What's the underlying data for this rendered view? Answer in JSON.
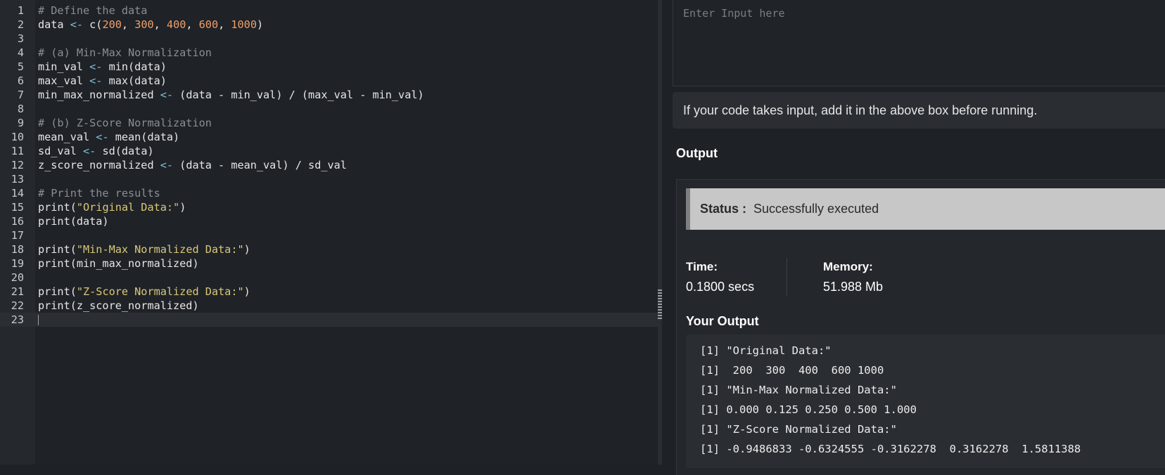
{
  "editor": {
    "lines": [
      {
        "n": "1",
        "tokens": [
          {
            "t": "# Define the data",
            "c": "comment"
          }
        ]
      },
      {
        "n": "2",
        "tokens": [
          {
            "t": "data ",
            "c": "plain"
          },
          {
            "t": "<-",
            "c": "op"
          },
          {
            "t": " c(",
            "c": "plain"
          },
          {
            "t": "200",
            "c": "num"
          },
          {
            "t": ", ",
            "c": "plain"
          },
          {
            "t": "300",
            "c": "num"
          },
          {
            "t": ", ",
            "c": "plain"
          },
          {
            "t": "400",
            "c": "num"
          },
          {
            "t": ", ",
            "c": "plain"
          },
          {
            "t": "600",
            "c": "num"
          },
          {
            "t": ", ",
            "c": "plain"
          },
          {
            "t": "1000",
            "c": "num"
          },
          {
            "t": ")",
            "c": "plain"
          }
        ]
      },
      {
        "n": "3",
        "tokens": []
      },
      {
        "n": "4",
        "tokens": [
          {
            "t": "# (a) Min-Max Normalization",
            "c": "comment"
          }
        ]
      },
      {
        "n": "5",
        "tokens": [
          {
            "t": "min_val ",
            "c": "plain"
          },
          {
            "t": "<-",
            "c": "op"
          },
          {
            "t": " min(data)",
            "c": "plain"
          }
        ]
      },
      {
        "n": "6",
        "tokens": [
          {
            "t": "max_val ",
            "c": "plain"
          },
          {
            "t": "<-",
            "c": "op"
          },
          {
            "t": " max(data)",
            "c": "plain"
          }
        ]
      },
      {
        "n": "7",
        "tokens": [
          {
            "t": "min_max_normalized ",
            "c": "plain"
          },
          {
            "t": "<-",
            "c": "op"
          },
          {
            "t": " (data - min_val) / (max_val - min_val)",
            "c": "plain"
          }
        ]
      },
      {
        "n": "8",
        "tokens": []
      },
      {
        "n": "9",
        "tokens": [
          {
            "t": "# (b) Z-Score Normalization",
            "c": "comment"
          }
        ]
      },
      {
        "n": "10",
        "tokens": [
          {
            "t": "mean_val ",
            "c": "plain"
          },
          {
            "t": "<-",
            "c": "op"
          },
          {
            "t": " mean(data)",
            "c": "plain"
          }
        ]
      },
      {
        "n": "11",
        "tokens": [
          {
            "t": "sd_val ",
            "c": "plain"
          },
          {
            "t": "<-",
            "c": "op"
          },
          {
            "t": " sd(data)",
            "c": "plain"
          }
        ]
      },
      {
        "n": "12",
        "tokens": [
          {
            "t": "z_score_normalized ",
            "c": "plain"
          },
          {
            "t": "<-",
            "c": "op"
          },
          {
            "t": " (data - mean_val) / sd_val",
            "c": "plain"
          }
        ]
      },
      {
        "n": "13",
        "tokens": []
      },
      {
        "n": "14",
        "tokens": [
          {
            "t": "# Print the results",
            "c": "comment"
          }
        ]
      },
      {
        "n": "15",
        "tokens": [
          {
            "t": "print(",
            "c": "plain"
          },
          {
            "t": "\"Original Data:\"",
            "c": "str"
          },
          {
            "t": ")",
            "c": "plain"
          }
        ]
      },
      {
        "n": "16",
        "tokens": [
          {
            "t": "print(data)",
            "c": "plain"
          }
        ]
      },
      {
        "n": "17",
        "tokens": []
      },
      {
        "n": "18",
        "tokens": [
          {
            "t": "print(",
            "c": "plain"
          },
          {
            "t": "\"Min-Max Normalized Data:\"",
            "c": "str"
          },
          {
            "t": ")",
            "c": "plain"
          }
        ]
      },
      {
        "n": "19",
        "tokens": [
          {
            "t": "print(min_max_normalized)",
            "c": "plain"
          }
        ]
      },
      {
        "n": "20",
        "tokens": []
      },
      {
        "n": "21",
        "tokens": [
          {
            "t": "print(",
            "c": "plain"
          },
          {
            "t": "\"Z-Score Normalized Data:\"",
            "c": "str"
          },
          {
            "t": ")",
            "c": "plain"
          }
        ]
      },
      {
        "n": "22",
        "tokens": [
          {
            "t": "print(z_score_normalized)",
            "c": "plain"
          }
        ]
      },
      {
        "n": "23",
        "tokens": [],
        "active": true
      }
    ]
  },
  "input": {
    "placeholder": "Enter Input here",
    "value": ""
  },
  "hint": "If your code takes input, add it in the above box before running.",
  "output": {
    "title": "Output",
    "status_label": "Status :",
    "status_value": "Successfully executed",
    "time_label": "Time:",
    "time_value": "0.1800 secs",
    "memory_label": "Memory:",
    "memory_value": "51.988 Mb",
    "your_output_label": "Your Output",
    "lines": [
      "[1] \"Original Data:\"",
      "[1]  200  300  400  600 1000",
      "[1] \"Min-Max Normalized Data:\"",
      "[1] 0.000 0.125 0.250 0.500 1.000",
      "[1] \"Z-Score Normalized Data:\"",
      "[1] -0.9486833 -0.6324555 -0.3162278  0.3162278  1.5811388"
    ]
  },
  "colors": {
    "comment": "#8a8f96",
    "number": "#f0a06a",
    "string": "#d9c877",
    "operator": "#7fbfd8",
    "status_bg": "#c7c7c7",
    "background": "#1e2126"
  }
}
